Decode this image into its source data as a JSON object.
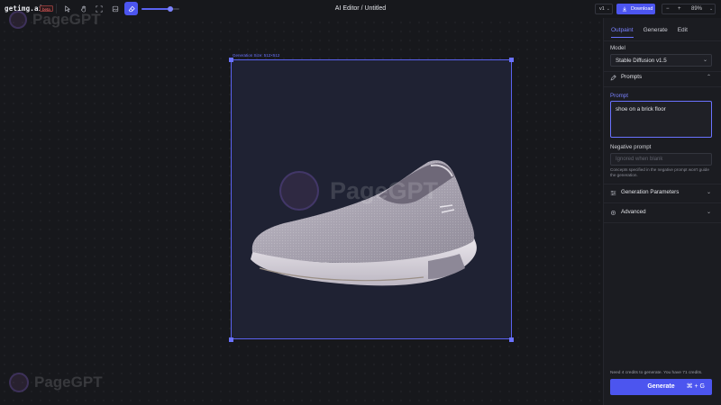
{
  "app": {
    "logo": "getimg.ai",
    "badge": "beta",
    "title": "AI Editor / Untitled"
  },
  "toolbar": {
    "tools": [
      "select-arrow-icon",
      "hand-icon",
      "crop-frame-icon",
      "image-add-icon",
      "eraser-icon"
    ],
    "active_tool": "eraser-icon",
    "brush_size": 0.75
  },
  "header": {
    "version": "v1",
    "download_label": "Download",
    "zoom_minus": "−",
    "zoom_plus": "+",
    "zoom_level": "89%"
  },
  "canvas": {
    "generation_size_label": "Generation Size: 512×512",
    "watermark": "PageGPT"
  },
  "panel": {
    "tabs": [
      {
        "label": "Outpaint"
      },
      {
        "label": "Generate"
      },
      {
        "label": "Edit"
      }
    ],
    "model_label": "Model",
    "model_value": "Stable Diffusion v1.5",
    "prompts_section": "Prompts",
    "prompt_label": "Prompt",
    "prompt_value": "shoe on a brick floor",
    "negative_label": "Negative prompt",
    "negative_placeholder": "Ignored when blank",
    "negative_hint": "Concepts specified in the negative prompt won't guide the generation.",
    "params_section": "Generation Parameters",
    "advanced_section": "Advanced",
    "credits_text": "Need 4 credits to generate. You have 71 credits.",
    "generate_label": "Generate",
    "generate_shortcut": "⌘ + G"
  },
  "colors": {
    "accent": "#4c55ef",
    "frame": "#5a62f0",
    "background": "#17181c",
    "panel": "#1b1c21"
  }
}
